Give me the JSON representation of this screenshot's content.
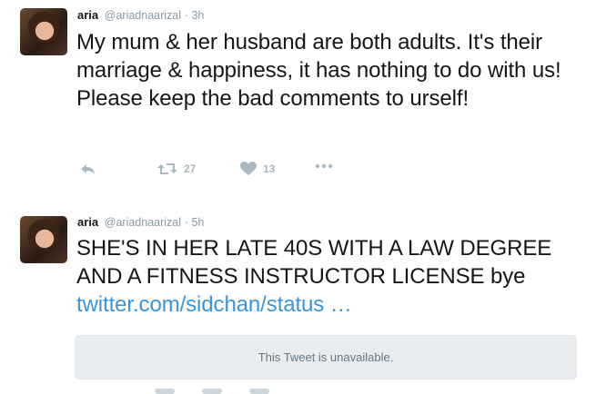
{
  "tweets": [
    {
      "name": "aria",
      "handle": "@ariadnaarizal",
      "separator": "·",
      "time": "3h",
      "text": "My mum & her husband are both adults. It's their marriage & happiness, it has nothing to do with us! Please keep the bad comments to urself!",
      "retweet_count": "27",
      "like_count": "13"
    },
    {
      "name": "aria",
      "handle": "@ariadnaarizal",
      "separator": "·",
      "time": "5h",
      "text": "SHE'S IN HER LATE 40S WITH A LAW DEGREE AND A FITNESS INSTRUCTOR LICENSE bye ",
      "link": "twitter.com/sidchan/status …",
      "quoted_card": "This Tweet is unavailable."
    }
  ],
  "icons": {
    "reply": "reply-icon",
    "retweet": "retweet-icon",
    "like": "heart-icon",
    "more": "more-icon"
  },
  "colors": {
    "link": "#3b94d9",
    "muted": "#8899a6",
    "action": "#aab8c2",
    "card_bg": "#e8ecef"
  }
}
